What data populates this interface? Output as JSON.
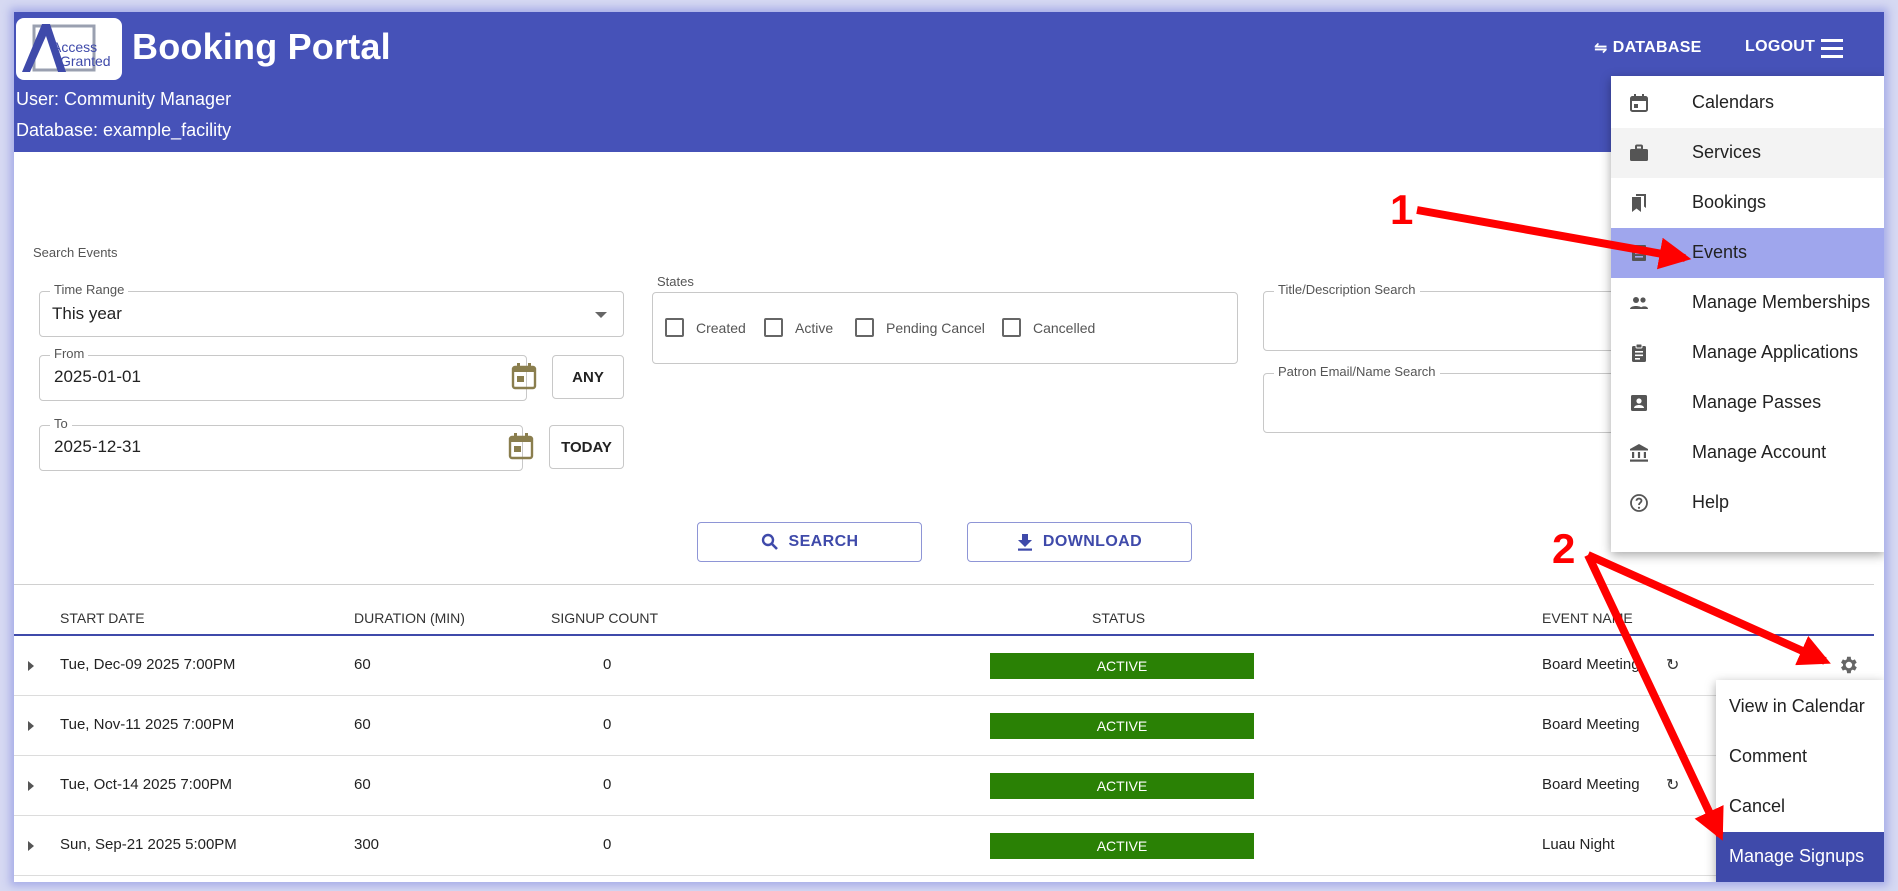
{
  "header": {
    "title": "Booking Portal",
    "logo_text_line1": "Access",
    "logo_text_line2": "Granted",
    "user_line": "User: Community Manager",
    "database_line": "Database: example_facility",
    "database_button": "DATABASE",
    "database_glyph": "⇋",
    "logout_button": "LOGOUT",
    "menu_icon": "hamburger-menu-icon"
  },
  "search": {
    "section_label": "Search Events",
    "time_range": {
      "label": "Time Range",
      "value": "This year"
    },
    "from": {
      "label": "From",
      "value": "2025-01-01",
      "button": "ANY"
    },
    "to": {
      "label": "To",
      "value": "2025-12-31",
      "button": "TODAY"
    },
    "states": {
      "label": "States",
      "options": [
        "Created",
        "Active",
        "Pending Cancel",
        "Cancelled"
      ]
    },
    "title_search": {
      "label": "Title/Description Search",
      "value": ""
    },
    "patron_search": {
      "label": "Patron Email/Name Search",
      "value": ""
    },
    "search_button": "SEARCH",
    "download_button": "DOWNLOAD"
  },
  "table": {
    "columns": [
      "START DATE",
      "DURATION (MIN)",
      "SIGNUP COUNT",
      "STATUS",
      "EVENT NAME"
    ],
    "rows": [
      {
        "start": "Tue, Dec-09 2025 7:00PM",
        "duration": "60",
        "signups": "0",
        "status": "ACTIVE",
        "name": "Board Meeting",
        "recurring": true
      },
      {
        "start": "Tue, Nov-11 2025 7:00PM",
        "duration": "60",
        "signups": "0",
        "status": "ACTIVE",
        "name": "Board Meeting",
        "recurring": false
      },
      {
        "start": "Tue, Oct-14 2025 7:00PM",
        "duration": "60",
        "signups": "0",
        "status": "ACTIVE",
        "name": "Board Meeting",
        "recurring": true
      },
      {
        "start": "Sun, Sep-21 2025 5:00PM",
        "duration": "300",
        "signups": "0",
        "status": "ACTIVE",
        "name": "Luau Night",
        "recurring": false
      }
    ],
    "recurring_glyph": "↻"
  },
  "nav_menu": {
    "items": [
      {
        "label": "Calendars",
        "icon": "calendar-icon"
      },
      {
        "label": "Services",
        "icon": "briefcase-icon"
      },
      {
        "label": "Bookings",
        "icon": "bookmarks-icon"
      },
      {
        "label": "Events",
        "icon": "list-icon"
      },
      {
        "label": "Manage Memberships",
        "icon": "people-icon"
      },
      {
        "label": "Manage Applications",
        "icon": "clipboard-icon"
      },
      {
        "label": "Manage Passes",
        "icon": "id-badge-icon"
      },
      {
        "label": "Manage Account",
        "icon": "bank-icon"
      },
      {
        "label": "Help",
        "icon": "help-circle-icon"
      }
    ],
    "selected": "Events",
    "hovered": "Services"
  },
  "context_menu": {
    "items": [
      "View in Calendar",
      "Comment",
      "Cancel",
      "Manage Signups"
    ],
    "selected": "Manage Signups"
  },
  "annotations": {
    "step1": "1",
    "step2": "2",
    "color": "#ff0000"
  },
  "colors": {
    "header": "#4652b8",
    "status_active": "#2a8105",
    "menu_selected": "#9fa6ed",
    "context_selected": "#3f4aaa",
    "accent": "#3f4aaa"
  }
}
